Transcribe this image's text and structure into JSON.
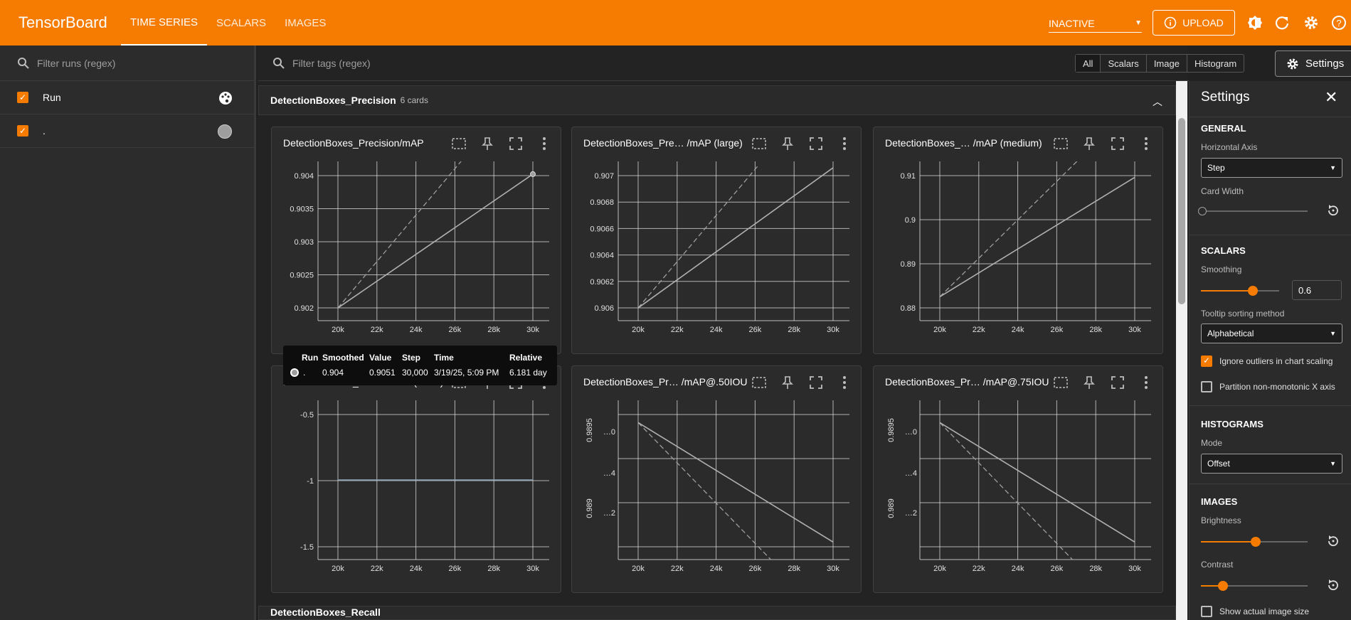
{
  "app": {
    "title": "TensorBoard",
    "tabs": [
      "TIME SERIES",
      "SCALARS",
      "IMAGES"
    ],
    "status_select": "INACTIVE",
    "upload_label": "UPLOAD"
  },
  "sidebar": {
    "filter_placeholder": "Filter runs (regex)",
    "header_label": "Run",
    "runs": [
      {
        "label": ".",
        "color": "#9e9e9e"
      }
    ]
  },
  "main": {
    "filter_placeholder": "Filter tags (regex)",
    "type_filters": [
      "All",
      "Scalars",
      "Image",
      "Histogram"
    ],
    "settings_button": "Settings",
    "group_title": "DetectionBoxes_Precision",
    "group_count": "6 cards",
    "next_group_title": "DetectionBoxes_Recall"
  },
  "cards": [
    {
      "title": "DetectionBoxes_Precision/mAP",
      "yticks": [
        "0.904",
        "0.9035",
        "0.903",
        "0.9025",
        "0.902"
      ],
      "xticks": [
        "20k",
        "22k",
        "24k",
        "26k",
        "28k",
        "30k"
      ]
    },
    {
      "title": "DetectionBoxes_Pre… /mAP (large)",
      "yticks": [
        "0.907",
        "0.9068",
        "0.9066",
        "0.9064",
        "0.9062",
        "0.906"
      ],
      "xticks": [
        "20k",
        "22k",
        "24k",
        "26k",
        "28k",
        "30k"
      ]
    },
    {
      "title": "DetectionBoxes_… /mAP (medium)",
      "yticks": [
        "0.91",
        "0.9",
        "0.89",
        "0.88"
      ],
      "xticks": [
        "20k",
        "22k",
        "24k",
        "26k",
        "28k",
        "30k"
      ]
    },
    {
      "title": "DetectionBoxes_Pre… /mAP (small)",
      "yticks": [
        "-0.5",
        "-1",
        "-1.5"
      ],
      "xticks": [
        "20k",
        "22k",
        "24k",
        "26k",
        "28k",
        "30k"
      ]
    },
    {
      "title": "DetectionBoxes_Pr… /mAP@.50IOU",
      "yticks": [
        "0.9895",
        "0.989"
      ],
      "yticks_inner": [
        "…0",
        "…4",
        "…2"
      ],
      "xticks": [
        "20k",
        "22k",
        "24k",
        "26k",
        "28k",
        "30k"
      ]
    },
    {
      "title": "DetectionBoxes_Pr… /mAP@.75IOU",
      "yticks": [
        "0.9895",
        "0.989"
      ],
      "yticks_inner": [
        "…0",
        "…4",
        "…2"
      ],
      "xticks": [
        "20k",
        "22k",
        "24k",
        "26k",
        "28k",
        "30k"
      ]
    }
  ],
  "tooltip": {
    "headers": [
      "Run",
      "Smoothed",
      "Value",
      "Step",
      "Time",
      "Relative"
    ],
    "values": [
      ".",
      "0.904",
      "0.9051",
      "30,000",
      "3/19/25, 5:09 PM",
      "6.181 day"
    ]
  },
  "settings": {
    "title": "Settings",
    "general": "GENERAL",
    "horizontal_axis_label": "Horizontal Axis",
    "horizontal_axis_value": "Step",
    "card_width_label": "Card Width",
    "scalars": "SCALARS",
    "smoothing_label": "Smoothing",
    "smoothing_value": "0.6",
    "tooltip_sort_label": "Tooltip sorting method",
    "tooltip_sort_value": "Alphabetical",
    "ignore_outliers": "Ignore outliers in chart scaling",
    "partition": "Partition non-monotonic X axis",
    "histograms": "HISTOGRAMS",
    "mode_label": "Mode",
    "mode_value": "Offset",
    "images": "IMAGES",
    "brightness_label": "Brightness",
    "contrast_label": "Contrast",
    "show_actual": "Show actual image size"
  },
  "colors": {
    "accent": "#f57c00",
    "background": "#212121",
    "card": "#2b2b2b"
  }
}
